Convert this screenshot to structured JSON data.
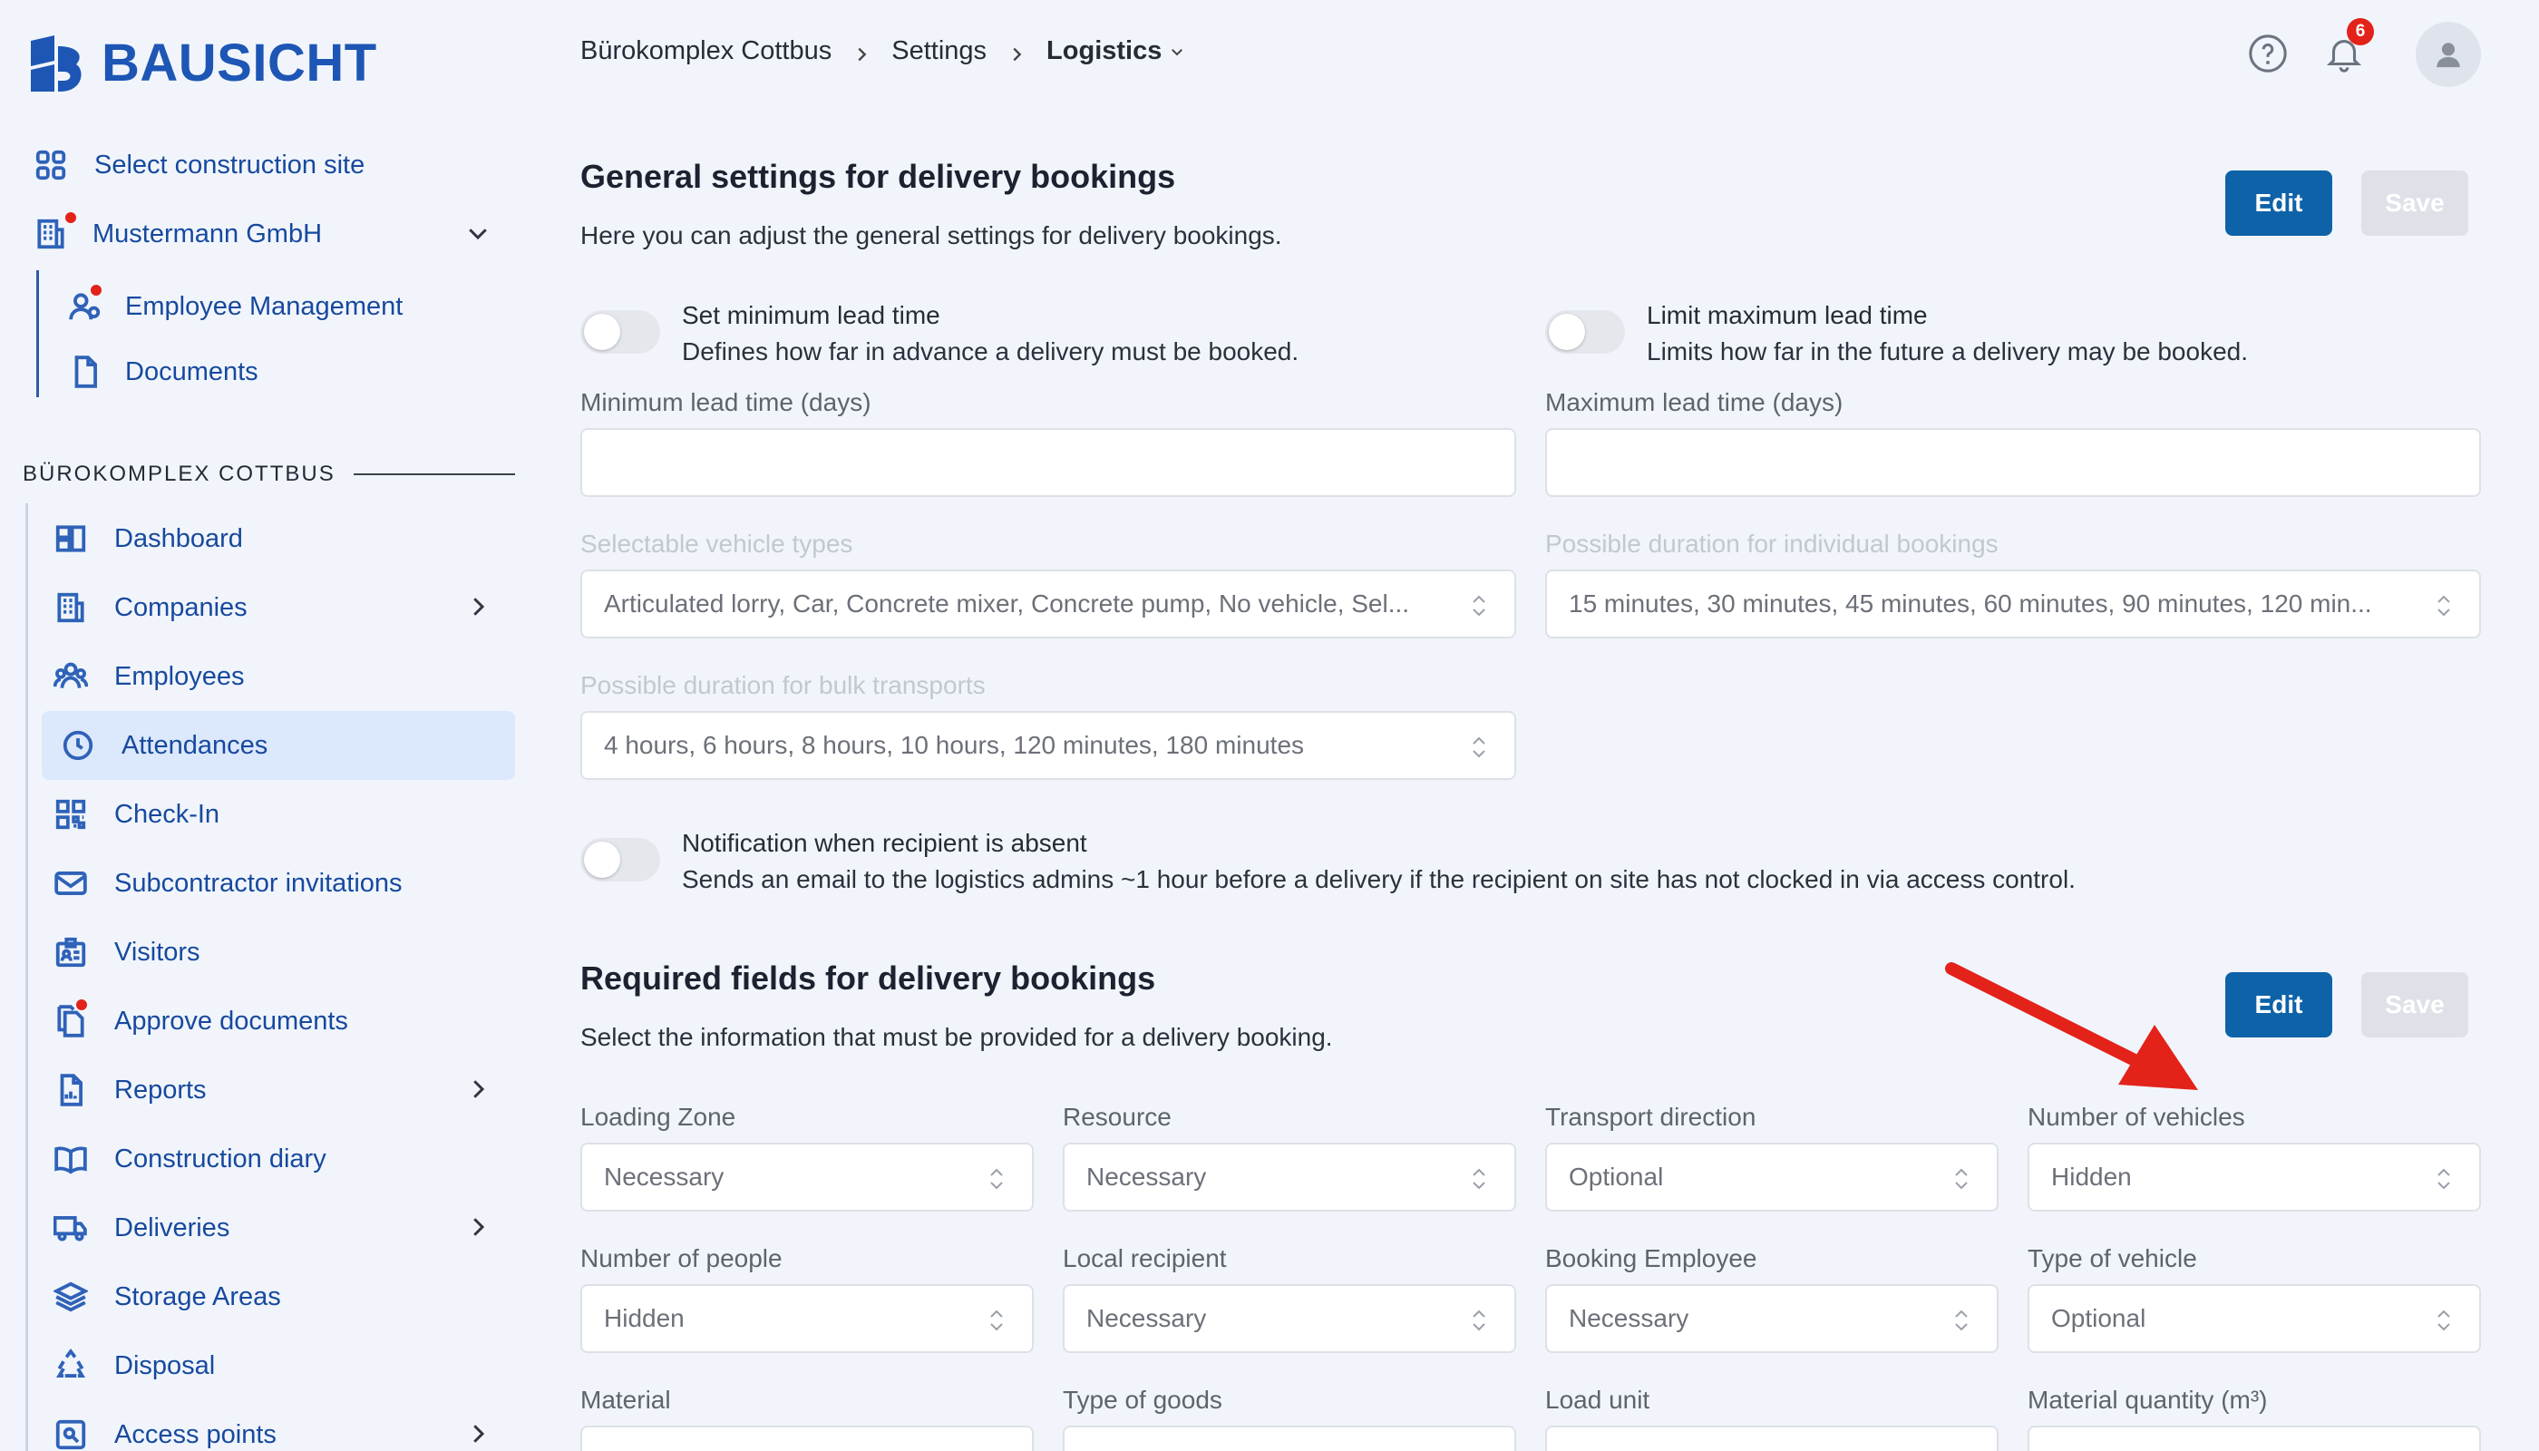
{
  "brand": {
    "name": "BAUSICHT",
    "color": "#1d56b4"
  },
  "sidebar": {
    "select_site": "Select construction site",
    "company": "Mustermann GmbH",
    "company_children": [
      "Employee Management",
      "Documents"
    ],
    "section_title": "BÜROKOMPLEX COTTBUS",
    "nav": [
      {
        "label": "Dashboard",
        "icon": "dashboard-icon"
      },
      {
        "label": "Companies",
        "icon": "building-icon"
      },
      {
        "label": "Employees",
        "icon": "users-icon"
      },
      {
        "label": "Attendances",
        "icon": "clock-icon",
        "active": true
      },
      {
        "label": "Check-In",
        "icon": "qr-code-icon"
      },
      {
        "label": "Subcontractor invitations",
        "icon": "envelope-icon"
      },
      {
        "label": "Visitors",
        "icon": "visitor-badge-icon"
      },
      {
        "label": "Approve documents",
        "icon": "documents-icon"
      },
      {
        "label": "Reports",
        "icon": "report-icon"
      },
      {
        "label": "Construction diary",
        "icon": "book-icon"
      },
      {
        "label": "Deliveries",
        "icon": "truck-icon"
      },
      {
        "label": "Storage Areas",
        "icon": "layers-icon"
      },
      {
        "label": "Disposal",
        "icon": "recycle-icon"
      },
      {
        "label": "Access points",
        "icon": "access-point-icon"
      }
    ]
  },
  "breadcrumb": {
    "items": [
      "Bürokomplex Cottbus",
      "Settings",
      "Logistics"
    ]
  },
  "notifications": {
    "count": "6"
  },
  "general": {
    "title": "General settings for delivery bookings",
    "description": "Here you can adjust the general settings for delivery bookings.",
    "edit_label": "Edit",
    "save_label": "Save",
    "min_toggle_title": "Set minimum lead time",
    "min_toggle_desc": "Defines how far in advance a delivery must be booked.",
    "max_toggle_title": "Limit maximum lead time",
    "max_toggle_desc": "Limits how far in the future a delivery may be booked.",
    "min_label": "Minimum lead time (days)",
    "max_label": "Maximum lead time (days)",
    "vehicle_types_label": "Selectable vehicle types",
    "vehicle_types_value": "Articulated lorry, Car, Concrete mixer, Concrete pump, No vehicle, Sel...",
    "durations_label": "Possible duration for individual bookings",
    "durations_value": "15 minutes, 30 minutes, 45 minutes, 60 minutes, 90 minutes, 120 min...",
    "bulk_label": "Possible duration for bulk transports",
    "bulk_value": "4 hours, 6 hours, 8 hours, 10 hours, 120 minutes, 180 minutes",
    "absent_title": "Notification when recipient is absent",
    "absent_desc": "Sends an email to the logistics admins ~1 hour before a delivery if the recipient on site has not clocked in via access control."
  },
  "required": {
    "title": "Required fields for delivery bookings",
    "description": "Select the information that must be provided for a delivery booking.",
    "edit_label": "Edit",
    "save_label": "Save",
    "fields": [
      {
        "label": "Loading Zone",
        "value": "Necessary"
      },
      {
        "label": "Resource",
        "value": "Necessary"
      },
      {
        "label": "Transport direction",
        "value": "Optional"
      },
      {
        "label": "Number of vehicles",
        "value": "Hidden"
      },
      {
        "label": "Number of people",
        "value": "Hidden"
      },
      {
        "label": "Local recipient",
        "value": "Necessary"
      },
      {
        "label": "Booking Employee",
        "value": "Necessary"
      },
      {
        "label": "Type of vehicle",
        "value": "Optional"
      },
      {
        "label": "Material",
        "value": ""
      },
      {
        "label": "Type of goods",
        "value": ""
      },
      {
        "label": "Load unit",
        "value": ""
      },
      {
        "label": "Material quantity (m³)",
        "value": ""
      }
    ]
  },
  "colors": {
    "primary_button": "#0e62a8",
    "annotation_arrow": "#e3221a",
    "active_nav": "#dce8fb"
  }
}
